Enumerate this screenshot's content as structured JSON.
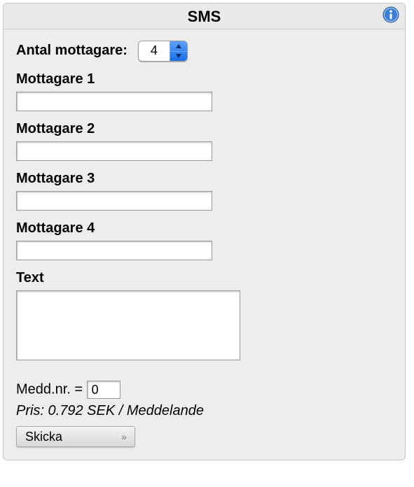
{
  "title": "SMS",
  "form": {
    "recipients_count_label": "Antal mottagare:",
    "recipients_count_value": "4",
    "recipients": [
      {
        "label": "Mottagare 1",
        "value": ""
      },
      {
        "label": "Mottagare 2",
        "value": ""
      },
      {
        "label": "Mottagare 3",
        "value": ""
      },
      {
        "label": "Mottagare 4",
        "value": ""
      }
    ],
    "text_label": "Text",
    "text_value": "",
    "medd_label": "Medd.nr. =",
    "medd_value": "0",
    "price_line": "Pris: 0.792 SEK / Meddelande",
    "submit_label": "Skicka"
  }
}
